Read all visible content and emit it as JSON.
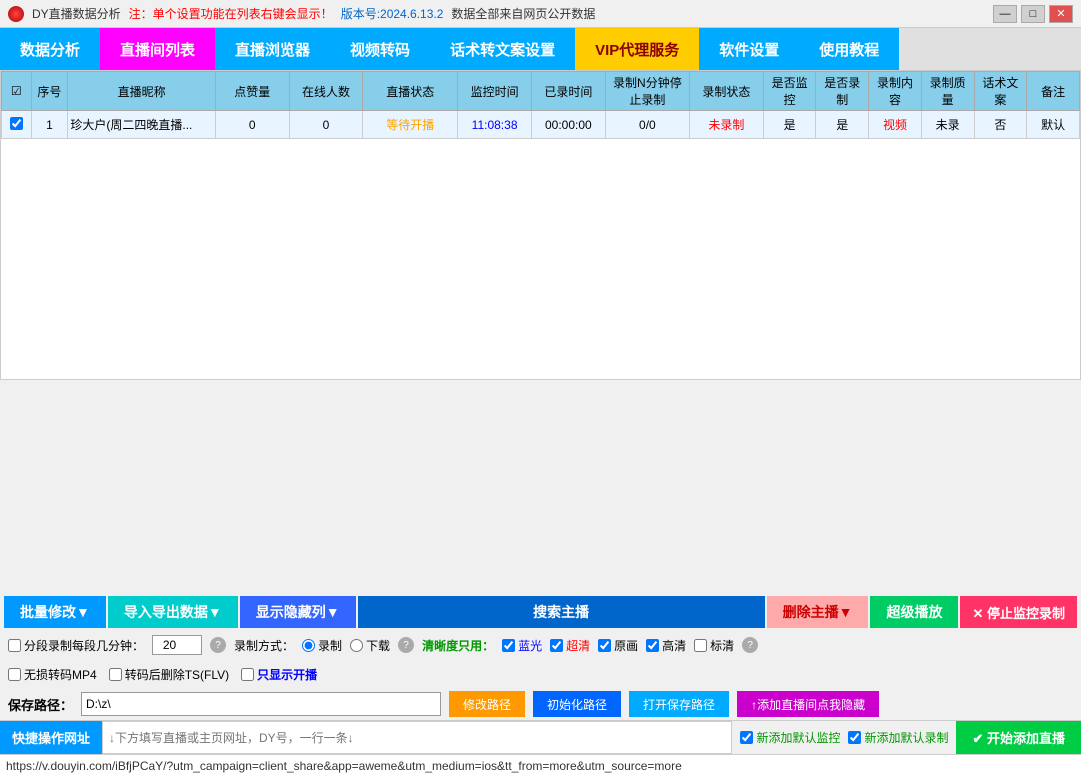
{
  "titleBar": {
    "appIcon": "dy-icon",
    "appName": "DY直播数据分析",
    "notice": "注：单个设置功能在列表右键会显示！",
    "version": "版本号:2024.6.13.2",
    "dataSource": "数据全部来自网页公开数据",
    "minimizeLabel": "—",
    "maximizeLabel": "□",
    "closeLabel": "✕"
  },
  "nav": {
    "items": [
      {
        "key": "data-analysis",
        "label": "数据分析",
        "style": "nav-data"
      },
      {
        "key": "live-list",
        "label": "直播间列表",
        "style": "nav-live-list"
      },
      {
        "key": "browser",
        "label": "直播浏览器",
        "style": "nav-browser"
      },
      {
        "key": "video-convert",
        "label": "视频转码",
        "style": "nav-video"
      },
      {
        "key": "speech-setting",
        "label": "话术转文案设置",
        "style": "nav-speech"
      },
      {
        "key": "vip-service",
        "label": "VIP代理服务",
        "style": "nav-vip"
      },
      {
        "key": "settings",
        "label": "软件设置",
        "style": "nav-settings"
      },
      {
        "key": "tutorial",
        "label": "使用教程",
        "style": "nav-tutorial"
      }
    ]
  },
  "table": {
    "columns": [
      {
        "key": "checkbox",
        "label": "☑",
        "width": "28"
      },
      {
        "key": "seq",
        "label": "序号",
        "width": "35"
      },
      {
        "key": "name",
        "label": "直播昵称",
        "width": "140"
      },
      {
        "key": "points",
        "label": "点赞量",
        "width": "70"
      },
      {
        "key": "online",
        "label": "在线人数",
        "width": "70"
      },
      {
        "key": "status",
        "label": "直播状态",
        "width": "90"
      },
      {
        "key": "monitor_time",
        "label": "监控时间",
        "width": "70"
      },
      {
        "key": "record_time",
        "label": "已录时间",
        "width": "70"
      },
      {
        "key": "auto_stop",
        "label": "录制N分钟停止录制",
        "width": "80"
      },
      {
        "key": "record_status",
        "label": "录制状态",
        "width": "70"
      },
      {
        "key": "is_monitor",
        "label": "是否监控",
        "width": "50"
      },
      {
        "key": "is_record",
        "label": "是否录制",
        "width": "50"
      },
      {
        "key": "record_content",
        "label": "录制内容",
        "width": "50"
      },
      {
        "key": "record_quality",
        "label": "录制质量",
        "width": "50"
      },
      {
        "key": "speech_text",
        "label": "话术文案",
        "width": "50"
      },
      {
        "key": "remark",
        "label": "备注",
        "width": "50"
      }
    ],
    "rows": [
      {
        "checked": true,
        "seq": "1",
        "name": "珍大户(周二四晚直播...",
        "points": "0",
        "online": "0",
        "status": "等待开播",
        "status_color": "orange",
        "monitor_time": "11:08:38",
        "monitor_time_color": "blue",
        "record_time": "00:00:00",
        "auto_stop": "0/0",
        "record_status": "未录制",
        "record_status_color": "red",
        "is_monitor": "是",
        "is_record": "是",
        "record_content": "视频",
        "record_content_color": "red",
        "record_quality": "未录",
        "speech_text": "否",
        "remark": "默认"
      }
    ]
  },
  "toolbar": {
    "batchModifyLabel": "批量修改▼",
    "importExportLabel": "导入导出数据▼",
    "showHideLabel": "显示隐藏列▼",
    "searchLabel": "搜索主播",
    "deleteLabel": "删除主播▼",
    "superPlayLabel": "超级播放",
    "stopMonitorLabel": "✕ 停止监控录制",
    "segmentRecord": {
      "label": "分段录制每段几分钟：",
      "value": "20",
      "helpText": "?"
    },
    "recordMode": {
      "label": "录制方式：",
      "options": [
        {
          "key": "record",
          "label": "录制",
          "checked": true
        },
        {
          "key": "download",
          "label": "下载",
          "checked": false
        }
      ],
      "helpText": "?"
    },
    "qualityOnly": {
      "label": "清晰度只用：",
      "options": [
        {
          "key": "blue",
          "label": "蓝光",
          "checked": true
        },
        {
          "key": "ultra",
          "label": "超清",
          "checked": true
        },
        {
          "key": "original",
          "label": "原画",
          "checked": true
        },
        {
          "key": "high",
          "label": "高清",
          "checked": true
        },
        {
          "key": "standard",
          "label": "标清",
          "checked": false
        }
      ],
      "helpText": "?"
    },
    "noLossConvert": {
      "label": "无损转码MP4",
      "checked": false
    },
    "deleteAfterConvert": {
      "label": "转码后删除TS(FLV)",
      "checked": false
    },
    "showOnlyLive": {
      "label": "只显示开播",
      "checked": false
    },
    "savePath": {
      "label": "保存路径：",
      "value": "D:\\z\\"
    },
    "modifyPathLabel": "修改路径",
    "initPathLabel": "初始化路径",
    "openSavePathLabel": "打开保存路径",
    "addHideLabel": "↑添加直播间点我隐藏",
    "quickOpLabel": "快捷操作网址",
    "urlPlaceholder": "↓下方填写直播或主页网址，DY号，一行一条↓",
    "defaultMonitorLabel": "✓ 新添加默认监控",
    "defaultRecordLabel": "✓ 新添加默认录制",
    "startAddLabel": "✔ 开始添加直播",
    "urlBar": "https://v.douyin.com/iBfjPCaY/?utm_campaign=client_share&app=aweme&utm_medium=ios&tt_from=more&utm_source=more"
  }
}
